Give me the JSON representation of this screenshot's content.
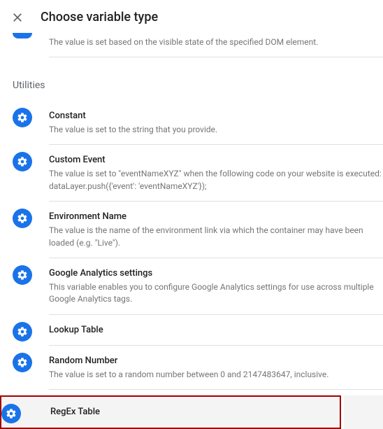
{
  "header": {
    "title": "Choose variable type"
  },
  "partial_item": {
    "description": "The value is set based on the visible state of the specified DOM element."
  },
  "section": {
    "title": "Utilities"
  },
  "items": {
    "constant": {
      "title": "Constant",
      "desc": "The value is set to the string that you provide."
    },
    "custom_event": {
      "title": "Custom Event",
      "desc": "The value is set to \"eventNameXYZ\" when the following code on your website is executed: dataLayer.push({'event': 'eventNameXYZ'});"
    },
    "environment_name": {
      "title": "Environment Name",
      "desc": "The value is the name of the environment link via which the container may have been loaded (e.g. \"Live\")."
    },
    "ga_settings": {
      "title": "Google Analytics settings",
      "desc": "This variable enables you to configure Google Analytics settings for use across multiple Google Analytics tags."
    },
    "lookup_table": {
      "title": "Lookup Table"
    },
    "random_number": {
      "title": "Random Number",
      "desc": "The value is set to a random number between 0 and 2147483647, inclusive."
    },
    "regex_table": {
      "title": "RegEx Table"
    }
  }
}
